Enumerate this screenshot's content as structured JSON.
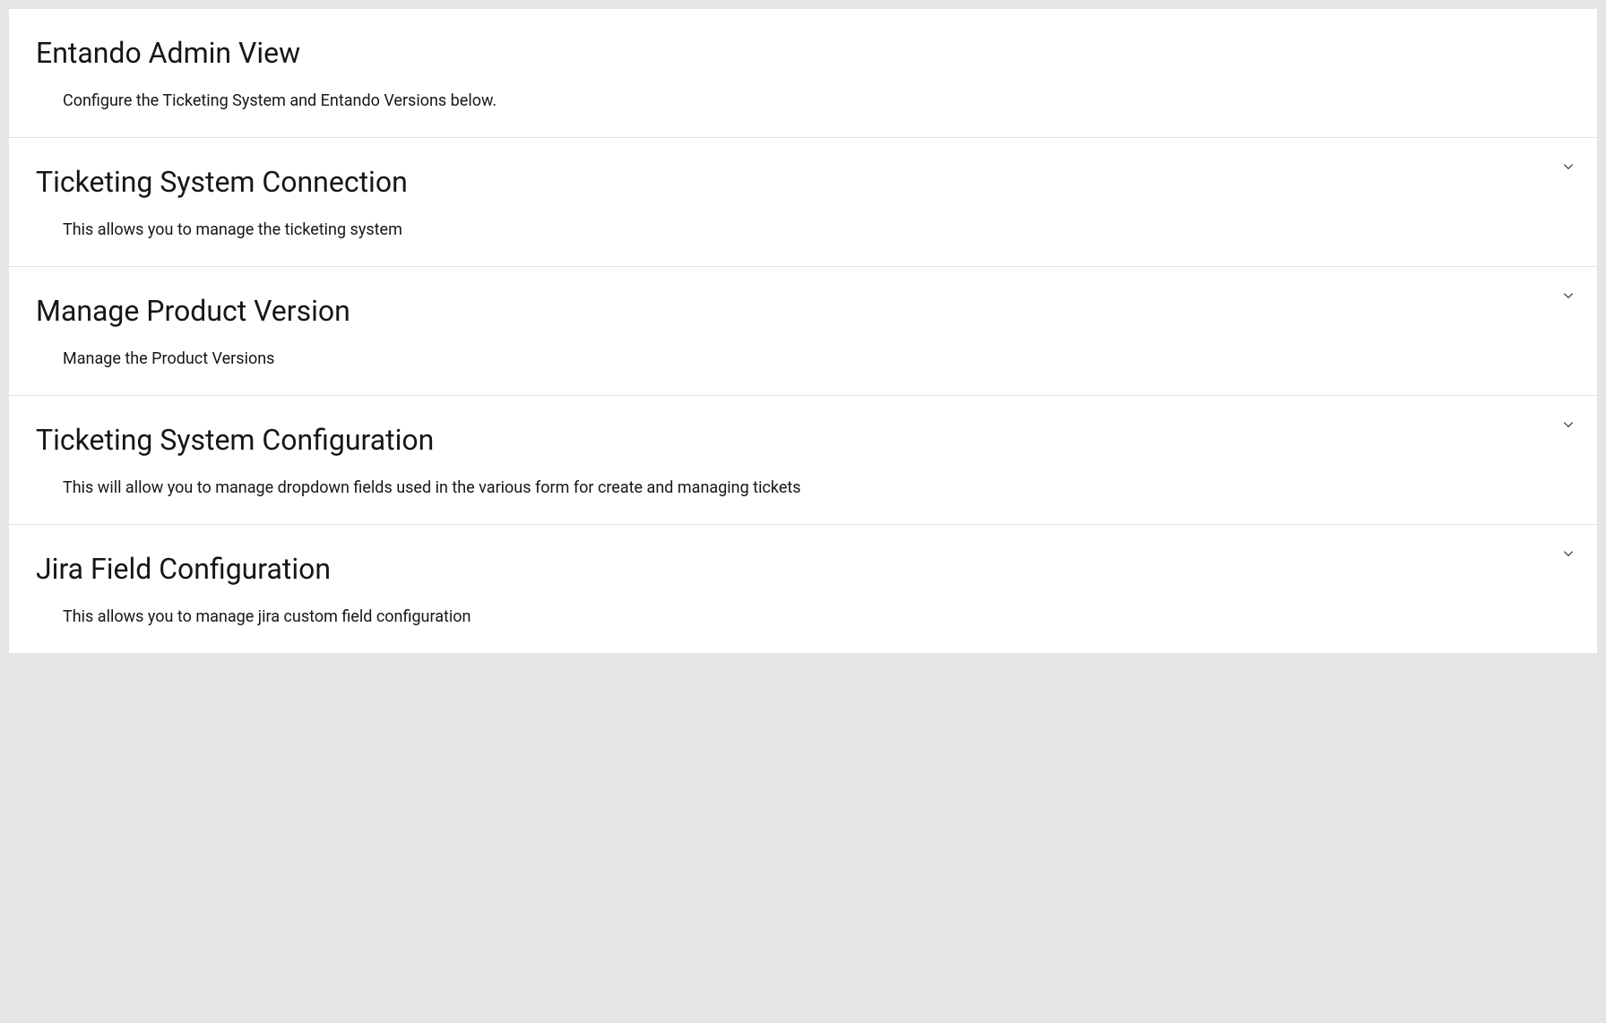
{
  "header": {
    "title": "Entando Admin View",
    "description": "Configure the Ticketing System and Entando Versions below."
  },
  "sections": [
    {
      "title": "Ticketing System Connection",
      "description": "This allows you to manage the ticketing system"
    },
    {
      "title": "Manage Product Version",
      "description": "Manage the Product Versions"
    },
    {
      "title": "Ticketing System Configuration",
      "description": "This will allow you to manage dropdown fields used in the various form for create and managing tickets"
    },
    {
      "title": "Jira Field Configuration",
      "description": "This allows you to manage jira custom field configuration"
    }
  ]
}
